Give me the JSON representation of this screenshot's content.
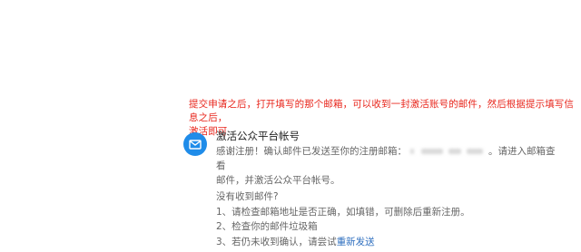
{
  "annotation": {
    "line1": "提交申请之后，打开填写的那个邮箱，可以收到一封激活账号的邮件，然后根据提示填写信息之后，",
    "line2": "激活即可"
  },
  "card": {
    "icon": "mail-icon",
    "title": "激活公众平台帐号",
    "body_prefix": "感谢注册！确认邮件已发送至你的注册邮箱：",
    "body_suffix": "。请进入邮箱查看",
    "body_line2": "邮件，并激活公众平台帐号。"
  },
  "help": {
    "title": "没有收到邮件?",
    "item1": "1、请检查邮箱地址是否正确，如填错，可删除后重新注册。",
    "item2": "2、检查你的邮件垃圾箱",
    "item3_prefix": "3、若仍未收到确认，请尝试",
    "resend_link": "重新发送"
  },
  "colors": {
    "annotation": "#e8261c",
    "icon_bg": "#1f8ce9",
    "link": "#2f6fbf"
  }
}
